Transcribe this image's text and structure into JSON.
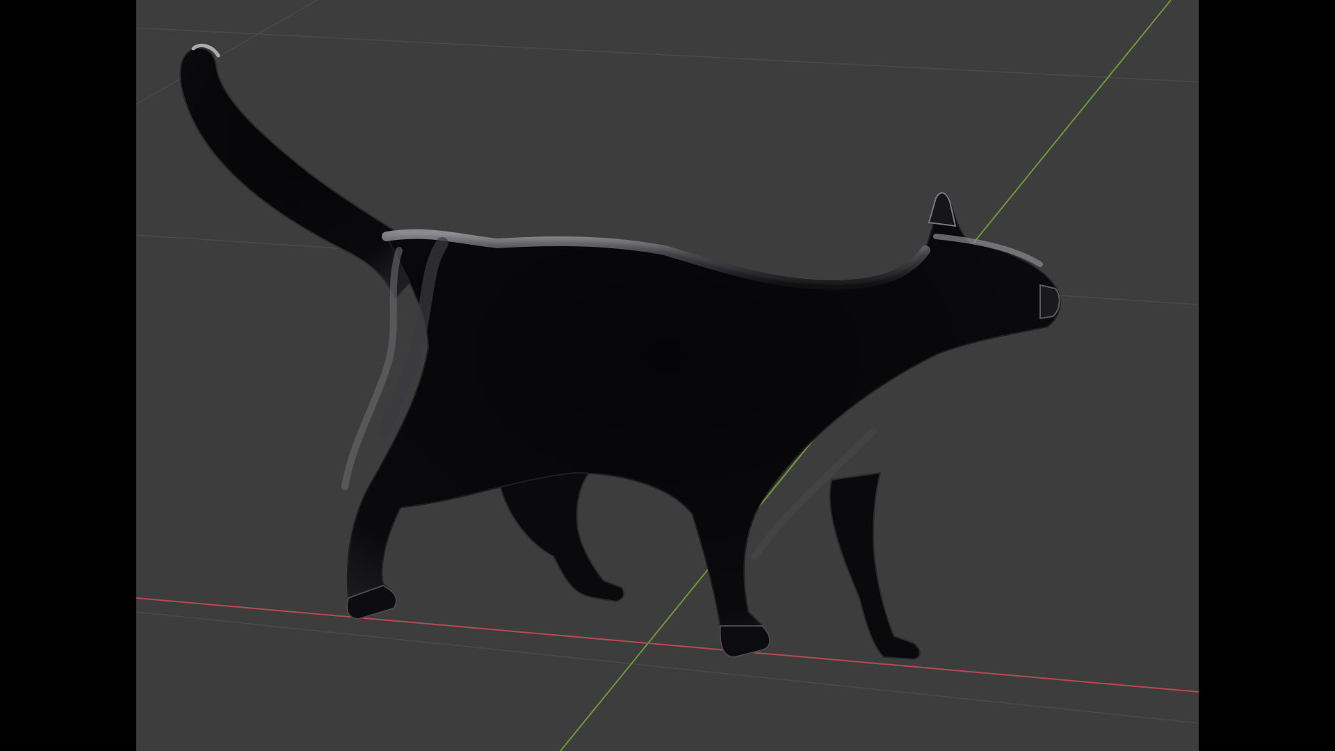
{
  "scene": {
    "viewport_background": "#3d3d3d",
    "letterbox_color": "#000000",
    "grid_line_color": "#4a4a4a",
    "x_axis_color": "#b84a52",
    "y_axis_color": "#6e9a3a",
    "object": {
      "name_icon": "cat-model",
      "material_base": "#0b0b0f",
      "material_highlight": "#8a8a8a",
      "pose": "walking"
    }
  }
}
